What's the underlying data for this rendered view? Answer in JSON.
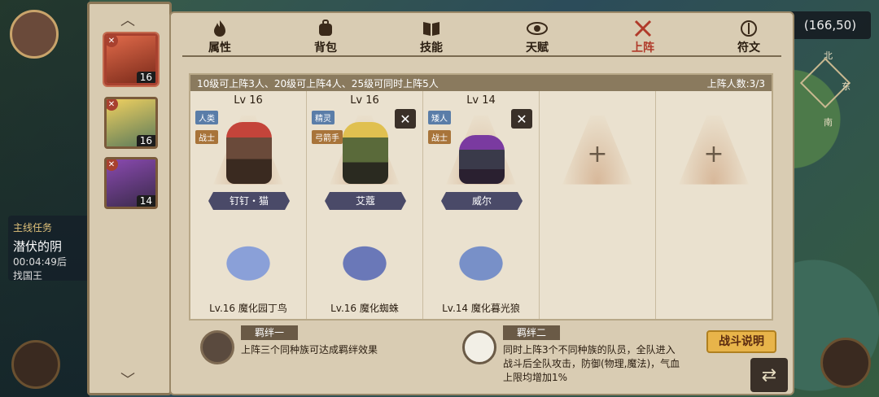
{
  "hud": {
    "coords": "(166,50)",
    "compass": {
      "north": "北",
      "east": "东",
      "south": "南"
    },
    "quest": {
      "title": "主线任务",
      "name": "潜伏的阴",
      "time": "00:04:49后",
      "sub": "找国王"
    }
  },
  "roster": [
    {
      "level": "16",
      "color": "#c4443a"
    },
    {
      "level": "16",
      "color": "#e0b83a"
    },
    {
      "level": "14",
      "color": "#6a3a88"
    }
  ],
  "tabs": [
    {
      "label": "属性",
      "icon": "flame-icon"
    },
    {
      "label": "背包",
      "icon": "backpack-icon"
    },
    {
      "label": "技能",
      "icon": "book-icon"
    },
    {
      "label": "天赋",
      "icon": "eye-icon"
    },
    {
      "label": "上阵",
      "icon": "crossed-swords-icon",
      "active": true
    },
    {
      "label": "符文",
      "icon": "rune-icon"
    }
  ],
  "lineup": {
    "rule": "10级可上阵3人、20级可上阵4人、25级可同时上阵5人",
    "count": "上阵人数:3/3",
    "slots": [
      {
        "lv": "Lv 16",
        "race": "人类",
        "job": "战士",
        "name": "钉钉・猫",
        "pet": "Lv.16 魔化园丁鸟",
        "color": "#c4443a",
        "removable": false
      },
      {
        "lv": "Lv 16",
        "race": "精灵",
        "job": "弓箭手",
        "name": "艾蔻",
        "pet": "Lv.16 魔化蜘蛛",
        "color": "#6a7a3a",
        "removable": true
      },
      {
        "lv": "Lv 14",
        "race": "矮人",
        "job": "战士",
        "name": "威尔",
        "pet": "Lv.14 魔化暮光狼",
        "color": "#6a3a88",
        "removable": true
      }
    ],
    "empty_slot": "+",
    "remove_symbol": "✕"
  },
  "bonds": [
    {
      "title": "羁绊一",
      "desc": "上阵三个同种族可达成羁绊效果"
    },
    {
      "title": "羁绊二",
      "desc": "同时上阵3个不同种族的队员，全队进入\n战斗后全队攻击，防御(物理,魔法)，气血\n上限均增加1%"
    }
  ],
  "buttons": {
    "battle_info": "战斗说明",
    "back": "⇄"
  },
  "colors": {
    "panel": "#d9ccb3",
    "active_tab": "#b03a2a",
    "button": "#e8b44a"
  }
}
